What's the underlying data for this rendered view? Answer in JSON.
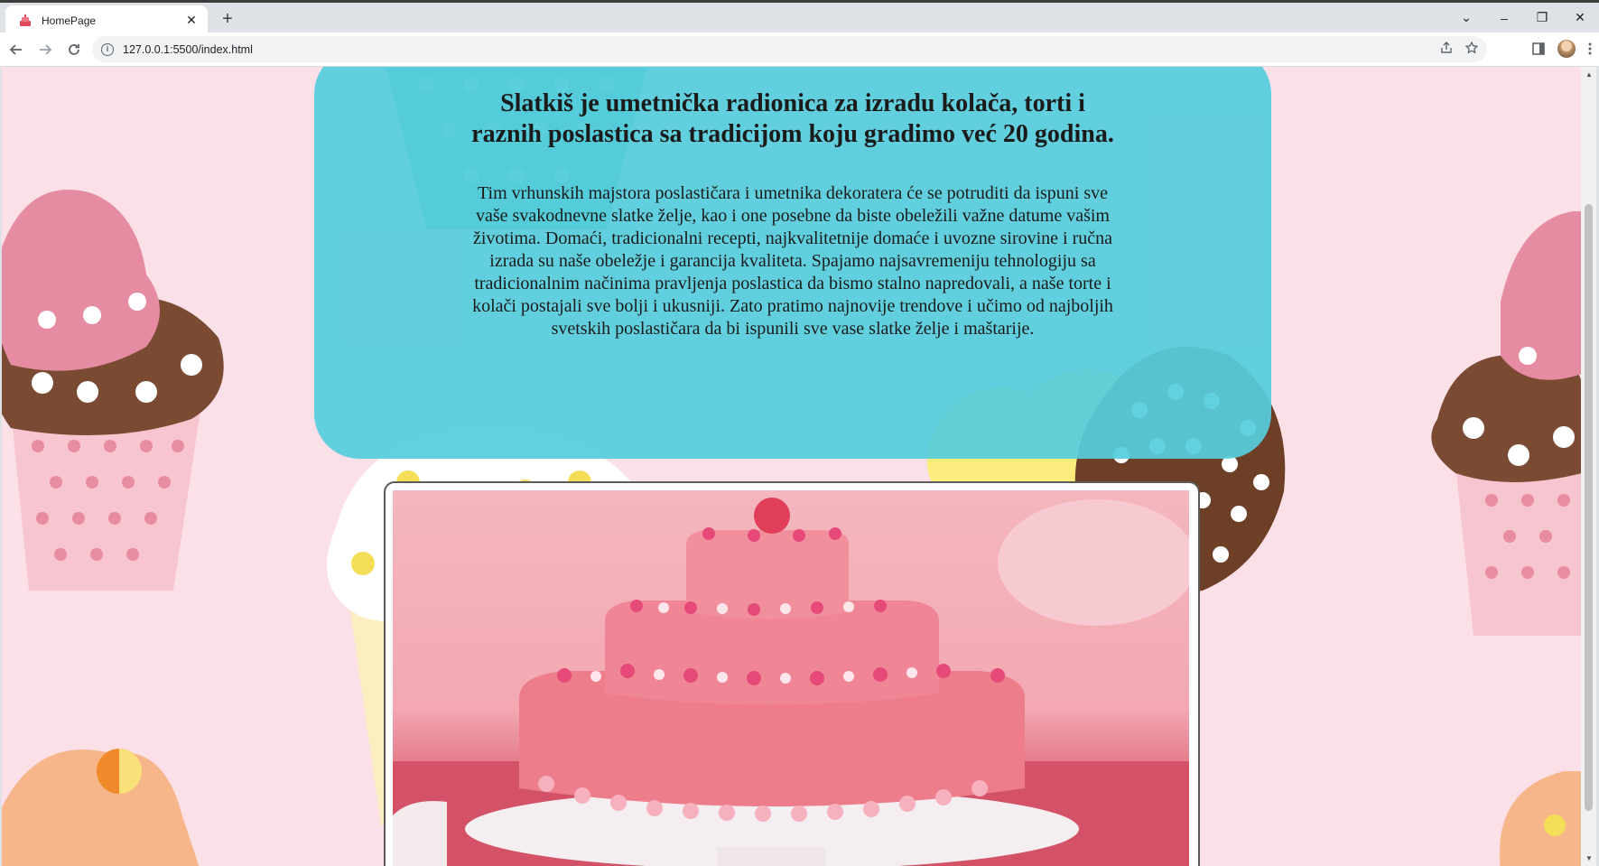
{
  "browser": {
    "tab_title": "HomePage",
    "tab_close": "✕",
    "new_tab": "+",
    "url": "127.0.0.1:5500/index.html",
    "controls": {
      "tabsearch": "⌄",
      "minimize": "–",
      "restore": "❐",
      "close": "✕"
    }
  },
  "content": {
    "heading": "Slatkiš je umetnička radionica za izradu kolača, torti i raznih poslastica sa tradicijom koju gradimo već 20 godina.",
    "paragraph": "Tim vrhunskih majstora poslastičara i umetnika dekoratera će se potruditi da ispuni sve vaše svakodnevne slatke želje, kao i one posebne da biste obeležili važne datume vašim životima. Domaći, tradicionalni recepti, najkvalitetnije domaće i uvozne sirovine i ručna izrada su naše obeležje i garancija kvaliteta. Spajamo najsavremeniju tehnologiju sa tradicionalnim načinima pravljenja poslastica da bismo stalno napredovali, a naše torte i kolači postajali sve bolji i ukusniji. Zato pratimo najnovije trendove i učimo od najboljih svetskih poslastičara da bi ispunili sve vase slatke želje i maštarije."
  },
  "colors": {
    "page_background": "#fbe0e8",
    "info_box": "#56cddd",
    "cake": "#ee7d8c"
  }
}
